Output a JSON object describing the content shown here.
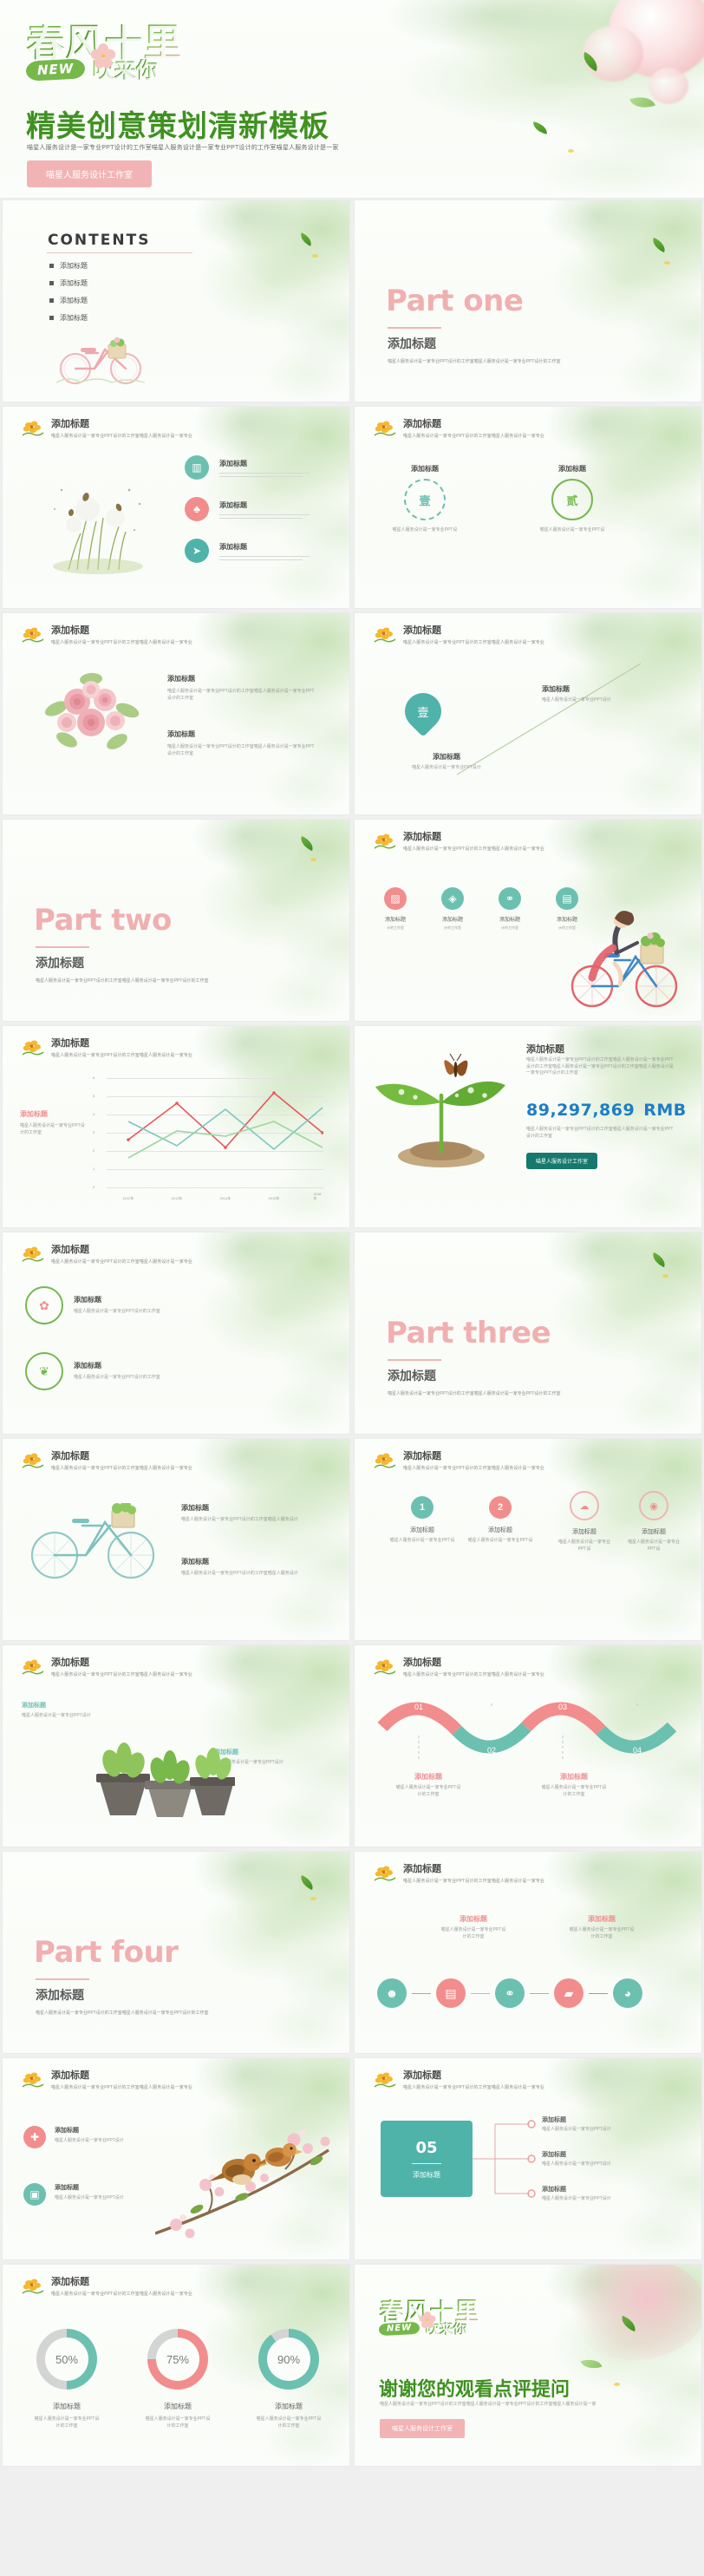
{
  "brand": {
    "logo_line1": "春风十里",
    "logo_badge": "NEW",
    "logo_line2": "吹来你"
  },
  "hero": {
    "title": "精美创意策划清新模板",
    "description": "喵星人服务设计是一家专业PPT设计的工作室喵星人服务设计是一家专业PPT设计的工作室喵星人服务设计是一家",
    "button": "喵星人服务设计工作室"
  },
  "common": {
    "add_title": "添加标题",
    "slide_desc_short": "喵星人服务设计是一家专业PPT设计的工作室喵星人服务设计是一家专业",
    "slide_desc_long": "喵星人服务设计是一家专业PPT设计的工作室喵星人服务设计是一家专业PPT设计的工作室",
    "body_line1": "喵星人服务设计是一家专业PPT设",
    "body_line2": "计的工作室"
  },
  "slides": [
    {
      "id": "contents",
      "name": "contents-slide",
      "heading": "CONTENTS",
      "items": [
        "添加标题",
        "添加标题",
        "添加标题",
        "添加标题"
      ],
      "art": "pink-bicycle"
    },
    {
      "id": "part-one",
      "name": "section-divider-part-one",
      "big": "Part one",
      "sub": "添加标题",
      "desc": "喵星人服务设计是一家专业PPT设计的工作室喵星人服务设计是一家专业PPT设计的工作室"
    },
    {
      "id": "icon-list",
      "name": "icon-list-slide",
      "title": "添加标题",
      "sub": "喵星人服务设计是一家专业PPT设计的工作室喵星人服务设计是一家专业",
      "art": "dandelion-grass",
      "rows": [
        {
          "icon": "bar-chart-icon",
          "glyph": "▥",
          "color": "#6cc0b0",
          "title": "添加标题"
        },
        {
          "icon": "bell-icon",
          "glyph": "🔔",
          "color": "#f28d8d",
          "title": "添加标题"
        },
        {
          "icon": "send-icon",
          "glyph": "➤",
          "color": "#4fb3aa",
          "title": "添加标题"
        }
      ]
    },
    {
      "id": "ring-pair",
      "name": "ring-pair-slide",
      "title": "添加标题",
      "sub": "喵星人服务设计是一家专业PPT设计的工作室喵星人服务设计是一家专业",
      "rings": [
        {
          "label": "壹",
          "color": "#74b84f",
          "caption": "添加标题"
        },
        {
          "label": "贰",
          "color": "#74b84f",
          "caption": "添加标题"
        }
      ]
    },
    {
      "id": "flower-two-col",
      "name": "two-column-text-slide",
      "title": "添加标题",
      "sub": "喵星人服务设计是一家专业PPT设计的工作室喵星人服务设计是一家专业",
      "art": "rose-bouquet",
      "cols": [
        {
          "heading": "添加标题",
          "body": "喵星人服务设计是一家专业PPT设计的工作室喵星人服务设计是一家专业PPT设计的工作室"
        },
        {
          "heading": "添加标题",
          "body": "喵星人服务设计是一家专业PPT设计的工作室喵星人服务设计是一家专业PPT设计的工作室"
        }
      ]
    },
    {
      "id": "pin-diagonal",
      "name": "pin-diagonal-slide",
      "title": "添加标题",
      "sub": "喵星人服务设计是一家专业PPT设计的工作室喵星人服务设计是一家专业",
      "pin_label": "壹",
      "items": [
        {
          "heading": "添加标题",
          "body": "喵星人服务设计是一家专业PPT设计"
        },
        {
          "heading": "添加标题",
          "body": "喵星人服务设计是一家专业PPT设计"
        }
      ]
    },
    {
      "id": "part-two",
      "name": "section-divider-part-two",
      "big": "Part two",
      "sub": "添加标题",
      "desc": "喵星人服务设计是一家专业PPT设计的工作室喵星人服务设计是一家专业PPT设计的工作室"
    },
    {
      "id": "icon-quad",
      "name": "icon-quad-slide",
      "title": "添加标题",
      "sub": "喵星人服务设计是一家专业PPT设计的工作室喵星人服务设计是一家专业",
      "art": "girl-on-bicycle",
      "icons": [
        {
          "icon": "chart-icon",
          "glyph": "▨",
          "color": "#f28d8d",
          "caption": "添加标题"
        },
        {
          "icon": "tag-icon",
          "glyph": "◈",
          "color": "#6cc0b0",
          "caption": "添加标题"
        },
        {
          "icon": "group-icon",
          "glyph": "⚭",
          "color": "#6cc0b0",
          "caption": "添加标题"
        },
        {
          "icon": "monitor-icon",
          "glyph": "▤",
          "color": "#6cc0b0",
          "caption": "添加标题"
        }
      ]
    },
    {
      "id": "line-chart",
      "name": "line-chart-slide",
      "title": "添加标题",
      "sub": "喵星人服务设计是一家专业PPT设计的工作室喵星人服务设计是一家专业",
      "side_label": "添加标题",
      "side_body": "喵星人服务设计是一家专业PPT设计的工作室"
    },
    {
      "id": "stat",
      "name": "key-figure-slide",
      "title": "添加标题",
      "art": "sprout-butterfly",
      "paragraph": "喵星人服务设计是一家专业PPT设计的工作室喵星人服务设计是一家专业PPT设计的工作室喵星人服务设计是一家专业PPT设计的工作室喵星人服务设计是一家专业PPT设计的工作室",
      "figure": "89,297,869",
      "unit": "RMB",
      "paragraph2": "喵星人服务设计是一家专业PPT设计的工作室喵星人服务设计是一家专业PPT设计的工作室",
      "button": "喵星人服务设计工作室"
    },
    {
      "id": "ring-stack",
      "name": "ring-stack-slide",
      "title": "添加标题",
      "sub": "喵星人服务设计是一家专业PPT设计的工作室喵星人服务设计是一家专业",
      "rings": [
        {
          "icon": "flower-icon",
          "glyph": "✿",
          "color": "#f28d8d",
          "caption": "添加标题",
          "body": "喵星人服务设计是一家专业PPT设计的工作室"
        },
        {
          "icon": "leaf-icon",
          "glyph": "❦",
          "color": "#74b84f",
          "caption": "添加标题",
          "body": "喵星人服务设计是一家专业PPT设计的工作室"
        }
      ]
    },
    {
      "id": "part-three",
      "name": "section-divider-part-three",
      "big": "Part three",
      "sub": "添加标题",
      "desc": "喵星人服务设计是一家专业PPT设计的工作室喵星人服务设计是一家专业PPT设计的工作室"
    },
    {
      "id": "bike-text",
      "name": "bicycle-text-slide",
      "title": "添加标题",
      "sub": "喵星人服务设计是一家专业PPT设计的工作室喵星人服务设计是一家专业",
      "art": "mint-bicycle",
      "cols": [
        {
          "heading": "添加标题",
          "body": "喵星人服务设计是一家专业PPT设计的工作室喵星人服务设计"
        },
        {
          "heading": "添加标题",
          "body": "喵星人服务设计是一家专业PPT设计的工作室喵星人服务设计"
        }
      ]
    },
    {
      "id": "numbered-four",
      "name": "numbered-four-slide",
      "title": "添加标题",
      "sub": "喵星人服务设计是一家专业PPT设计的工作室喵星人服务设计是一家专业",
      "steps": [
        {
          "num": "1",
          "color": "#6cc0b0",
          "caption": "添加标题"
        },
        {
          "num": "2",
          "color": "#f28d8d",
          "caption": "添加标题"
        }
      ],
      "ring_items": [
        {
          "icon": "cloud-icon",
          "glyph": "☁",
          "color": "#f28d8d",
          "caption": "添加标题"
        },
        {
          "icon": "lightbulb-icon",
          "glyph": "💡",
          "color": "#f28d8d",
          "caption": "添加标题"
        }
      ]
    },
    {
      "id": "pots",
      "name": "planter-list-slide",
      "title": "添加标题",
      "sub": "喵星人服务设计是一家专业PPT设计的工作室喵星人服务设计是一家专业",
      "art": "potted-plants",
      "items": [
        {
          "heading": "添加标题",
          "body": "喵星人服务设计是一家专业PPT设计"
        },
        {
          "heading": "添加标题",
          "body": "喵星人服务设计是一家专业PPT设计"
        }
      ]
    },
    {
      "id": "wave-process",
      "name": "wave-process-slide",
      "title": "添加标题",
      "sub": "喵星人服务设计是一家专业PPT设计的工作室喵星人服务设计是一家专业",
      "segments": [
        {
          "num": "01",
          "color": "#f28d8d"
        },
        {
          "num": "02",
          "color": "#6cc0b0"
        },
        {
          "num": "03",
          "color": "#f28d8d"
        },
        {
          "num": "04",
          "color": "#6cc0b0"
        }
      ],
      "captions": [
        {
          "heading": "添加标题",
          "line1": "喵星人服务设计是一家专业PPT设",
          "line2": "计的工作室"
        },
        {
          "heading": "添加标题",
          "line1": "喵星人服务设计是一家专业PPT设",
          "line2": "计的工作室"
        }
      ]
    },
    {
      "id": "part-four",
      "name": "section-divider-part-four",
      "big": "Part four",
      "sub": "添加标题",
      "desc": "喵星人服务设计是一家专业PPT设计的工作室喵星人服务设计是一家专业PPT设计的工作室"
    },
    {
      "id": "icon-chain",
      "name": "icon-chain-slide",
      "title": "添加标题",
      "sub": "喵星人服务设计是一家专业PPT设计的工作室喵星人服务设计是一家专业",
      "captions": [
        {
          "heading": "添加标题",
          "line1": "喵星人服务设计是一家专业PPT设",
          "line2": "计的工作室"
        },
        {
          "heading": "添加标题",
          "line1": "喵星人服务设计是一家专业PPT设",
          "line2": "计的工作室"
        }
      ],
      "chain": [
        {
          "icon": "user-icon",
          "glyph": "👤",
          "color": "#6cc0b0"
        },
        {
          "icon": "presentation-icon",
          "glyph": "▤",
          "color": "#f28d8d"
        },
        {
          "icon": "team-icon",
          "glyph": "👥",
          "color": "#6cc0b0"
        },
        {
          "icon": "growth-chart-icon",
          "glyph": "▰",
          "color": "#f28d8d"
        },
        {
          "icon": "brain-icon",
          "glyph": "◕",
          "color": "#6cc0b0"
        }
      ]
    },
    {
      "id": "bird-icons",
      "name": "bird-icon-slide",
      "title": "添加标题",
      "sub": "喵星人服务设计是一家专业PPT设计的工作室喵星人服务设计是一家专业",
      "art": "birds-on-blossom-branch",
      "items": [
        {
          "icon": "first-aid-icon",
          "glyph": "✚",
          "color": "#f28d8d",
          "heading": "添加标题",
          "body": "喵星人服务设计是一家专业PPT设计"
        },
        {
          "icon": "book-icon",
          "glyph": "▣",
          "color": "#6cc0b0",
          "heading": "添加标题",
          "body": "喵星人服务设计是一家专业PPT设计"
        }
      ]
    },
    {
      "id": "card-branch",
      "name": "card-branch-slide",
      "title": "添加标题",
      "sub": "喵星人服务设计是一家专业PPT设计的工作室喵星人服务设计是一家专业",
      "card": {
        "num": "05",
        "label": "添加标题",
        "color": "#4fb3aa"
      },
      "branches": [
        {
          "heading": "添加标题",
          "body": "喵星人服务设计是一家专业PPT设计"
        },
        {
          "heading": "添加标题",
          "body": "喵星人服务设计是一家专业PPT设计"
        },
        {
          "heading": "添加标题",
          "body": "喵星人服务设计是一家专业PPT设计"
        }
      ]
    },
    {
      "id": "donuts",
      "name": "donut-stats-slide",
      "title": "添加标题",
      "sub": "喵星人服务设计是一家专业PPT设计的工作室喵星人服务设计是一家专业",
      "donuts": [
        {
          "value": "50%",
          "color": "#6cc0b0",
          "caption": "添加标题",
          "line1": "喵星人服务设计是一家专业PPT设",
          "line2": "计的工作室"
        },
        {
          "value": "75%",
          "color": "#f28d8d",
          "caption": "添加标题",
          "line1": "喵星人服务设计是一家专业PPT设",
          "line2": "计的工作室"
        },
        {
          "value": "90%",
          "color": "#6cc0b0",
          "caption": "添加标题",
          "line1": "喵星人服务设计是一家专业PPT设",
          "line2": "计的工作室"
        }
      ]
    },
    {
      "id": "thanks",
      "name": "thank-you-slide",
      "title": "谢谢您的观看点评提问",
      "desc": "喵星人服务设计是一家专业PPT设计的工作室喵星人服务设计是一家专业PPT设计的工作室喵星人服务设计是一家",
      "button": "喵星人服务设计工作室"
    }
  ],
  "chart_data": {
    "type": "line",
    "title": "添加标题",
    "x": [
      "2012年",
      "2013年",
      "2014年",
      "2015年",
      "2016年"
    ],
    "ylim": [
      0,
      6
    ],
    "yticks": [
      0,
      1,
      2,
      3,
      4,
      5,
      6
    ],
    "grid": true,
    "legend_position": "left",
    "series": [
      {
        "name": "添加标题",
        "color": "#e8565b",
        "values": [
          2.6,
          4.6,
          2.2,
          5.2,
          3.0
        ]
      },
      {
        "name": "添加标题",
        "color": "#7ec6bd",
        "values": [
          3.6,
          2.3,
          4.3,
          2.1,
          4.4
        ]
      },
      {
        "name": "添加标题",
        "color": "#9ed7a0",
        "values": [
          1.6,
          3.1,
          2.8,
          3.6,
          2.2
        ]
      }
    ],
    "xlabel": "",
    "ylabel": ""
  },
  "donut_chart_data": {
    "type": "pie",
    "title": "添加标题",
    "categories": [
      "添加标题",
      "添加标题",
      "添加标题"
    ],
    "values": [
      50,
      75,
      90
    ],
    "colors": [
      "#6cc0b0",
      "#f28d8d",
      "#6cc0b0"
    ]
  }
}
